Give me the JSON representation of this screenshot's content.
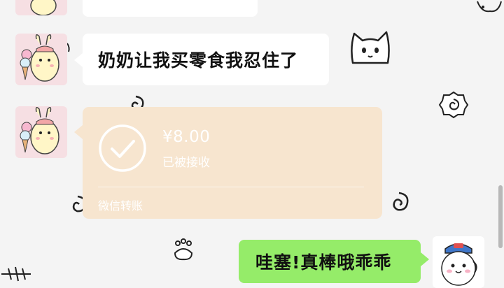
{
  "messages": [
    {
      "side": "left",
      "text": "奶奶让我买零食我忍住了"
    },
    {
      "side": "right",
      "text": "哇塞!真棒哦乖乖"
    }
  ],
  "transfer": {
    "amount": "¥8.00",
    "status": "已被接收",
    "label": "微信转账"
  },
  "colors": {
    "background": "#f4f4f4",
    "bubble_white": "#ffffff",
    "bubble_green": "#95ec69",
    "transfer_card": "#f7e5cf"
  },
  "icons": {
    "received": "check-circle-icon",
    "doodles": [
      "cat-face-icon",
      "swirl-icon",
      "paw-icon",
      "fish-bone-icon",
      "sparkle-icon"
    ]
  }
}
